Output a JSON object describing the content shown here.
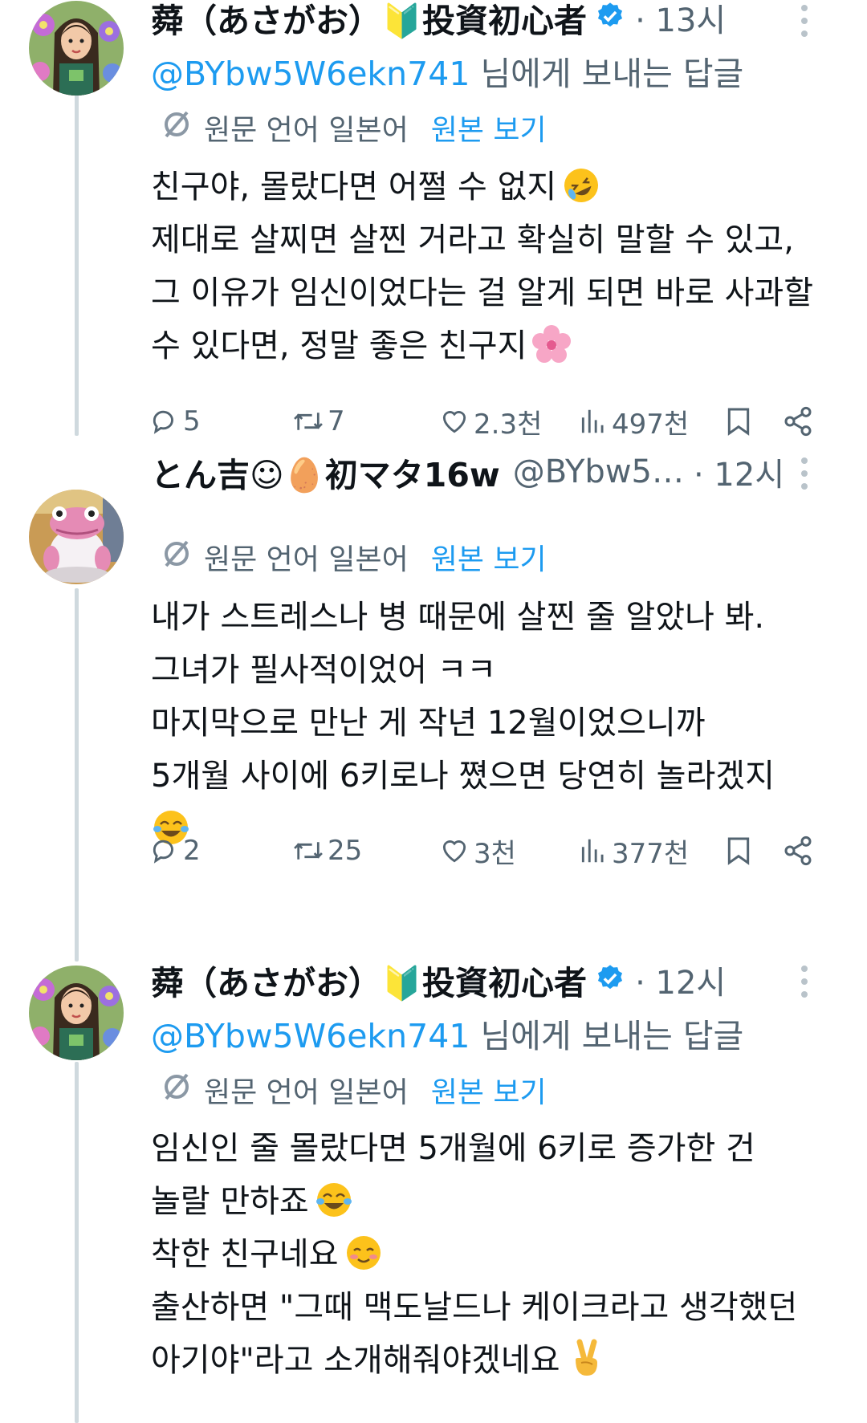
{
  "posts": [
    {
      "author": "蕣（あさがお）🔰投資初心者",
      "verified": true,
      "time": "· 13시",
      "reply_to_handle": "@BYbw5W6ekn741",
      "reply_to_suffix": " 님에게 보내는 답글",
      "translate_label": "원문 언어 일본어",
      "translate_link": "원본 보기",
      "lines": [
        "친구야, 몰랐다면 어쩔 수 없지",
        "제대로 살찌면 살찐 거라고 확실히 말할 수 있고,",
        "그 이유가 임신이었다는 걸 알게 되면 바로 사과할",
        "수 있다면, 정말 좋은 친구지"
      ],
      "emoji_1": "rolling-laughing-emoji",
      "emoji_2": "cherry-blossom-emoji",
      "stats": {
        "replies": "5",
        "reposts": "7",
        "likes": "2.3천",
        "views": "497천"
      }
    },
    {
      "author": "とん吉☺︎🥚初マタ16w",
      "handle": "@BYbw5…",
      "time": "· 12시",
      "translate_label": "원문 언어 일본어",
      "translate_link": "원본 보기",
      "lines": [
        "내가 스트레스나 병 때문에 살찐 줄 알았나 봐.",
        "그녀가 필사적이었어 ㅋㅋ",
        "마지막으로 만난 게 작년 12월이었으니까",
        "5개월 사이에 6키로나 쪘으면 당연히 놀라겠지"
      ],
      "emoji_1": "tears-of-joy-emoji",
      "stats": {
        "replies": "2",
        "reposts": "25",
        "likes": "3천",
        "views": "377천"
      }
    },
    {
      "author": "蕣（あさがお）🔰投資初心者",
      "verified": true,
      "time": "· 12시",
      "reply_to_handle": "@BYbw5W6ekn741",
      "reply_to_suffix": " 님에게 보내는 답글",
      "translate_label": "원문 언어 일본어",
      "translate_link": "원본 보기",
      "lines": [
        "임신인 줄 몰랐다면 5개월에 6키로 증가한 건",
        "놀랄 만하죠",
        "착한 친구네요",
        "출산하면 \"그때 맥도날드나 케이크라고 생각했던",
        "아기야\"라고 소개해줘야겠네요"
      ],
      "emoji_1": "tears-of-joy-emoji",
      "emoji_2": "smiling-blush-emoji",
      "emoji_3": "victory-hand-emoji"
    }
  ],
  "colors": {
    "link": "#1d9bf0",
    "muted": "#536471",
    "text": "#0f1419",
    "thread": "#cfd9de"
  }
}
